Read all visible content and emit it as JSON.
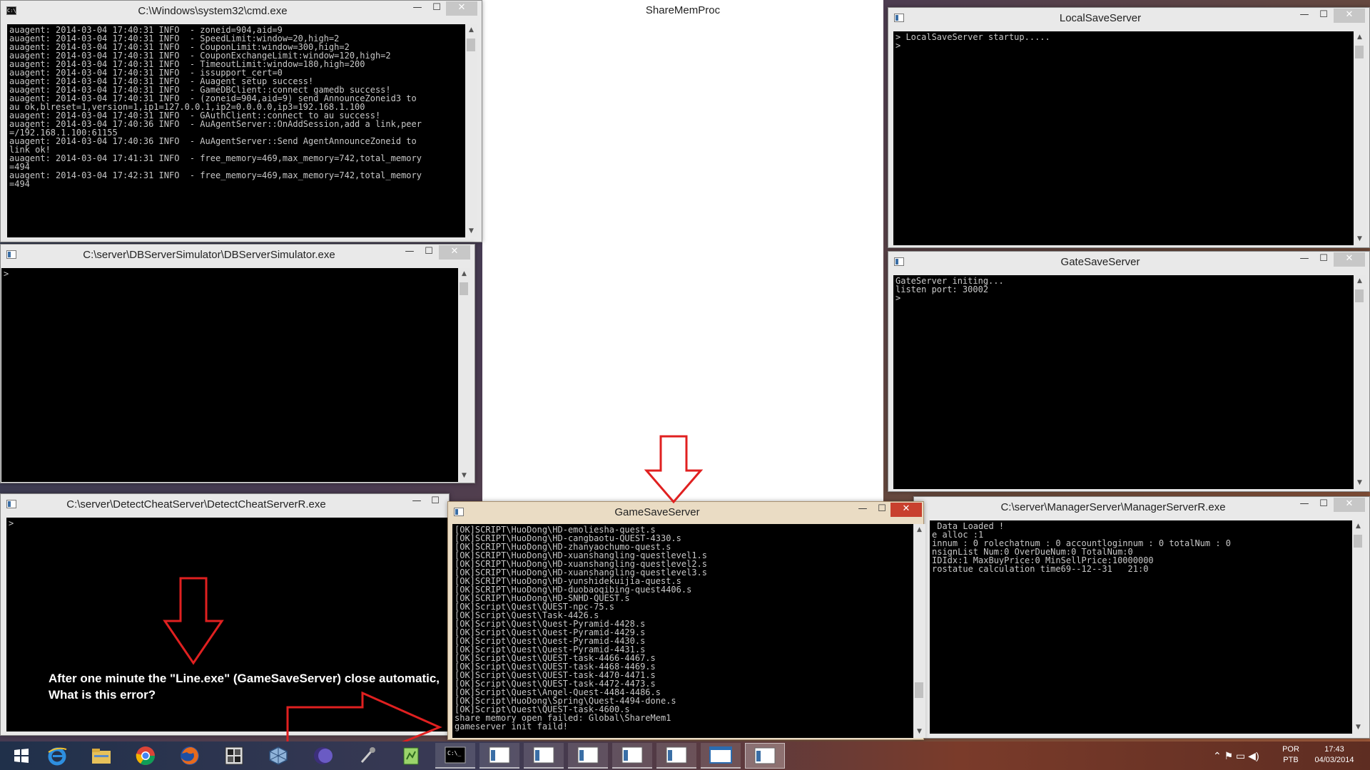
{
  "windows": {
    "cmd": {
      "title": "C:\\Windows\\system32\\cmd.exe",
      "lines": [
        "auagent: 2014-03-04 17:40:31 INFO  - zoneid=904,aid=9",
        "auagent: 2014-03-04 17:40:31 INFO  - SpeedLimit:window=20,high=2",
        "auagent: 2014-03-04 17:40:31 INFO  - CouponLimit:window=300,high=2",
        "auagent: 2014-03-04 17:40:31 INFO  - CouponExchangeLimit:window=120,high=2",
        "auagent: 2014-03-04 17:40:31 INFO  - TimeoutLimit:window=180,high=200",
        "auagent: 2014-03-04 17:40:31 INFO  - issupport_cert=0",
        "auagent: 2014-03-04 17:40:31 INFO  - Auagent setup success!",
        "auagent: 2014-03-04 17:40:31 INFO  - GameDBClient::connect gamedb success!",
        "auagent: 2014-03-04 17:40:31 INFO  - (zoneid=904,aid=9) send AnnounceZoneid3 to",
        "au ok,blreset=1,version=1,ip1=127.0.0.1,ip2=0.0.0.0,ip3=192.168.1.100",
        "auagent: 2014-03-04 17:40:31 INFO  - GAuthClient::connect to au success!",
        "auagent: 2014-03-04 17:40:36 INFO  - AuAgentServer::OnAddSession,add a link,peer",
        "=/192.168.1.100:61155",
        "auagent: 2014-03-04 17:40:36 INFO  - AuAgentServer::Send AgentAnnounceZoneid to",
        "link ok!",
        "auagent: 2014-03-04 17:41:31 INFO  - free_memory=469,max_memory=742,total_memory",
        "=494",
        "auagent: 2014-03-04 17:42:31 INFO  - free_memory=469,max_memory=742,total_memory",
        "=494"
      ]
    },
    "sharemem": {
      "title": "ShareMemProc"
    },
    "local_save": {
      "title": "LocalSaveServer",
      "lines": [
        "> LocalSaveServer startup.....",
        ">"
      ]
    },
    "db_server": {
      "title": "C:\\server\\DBServerSimulator\\DBServerSimulator.exe",
      "lines": [
        ">"
      ]
    },
    "gate_save": {
      "title": "GateSaveServer",
      "lines": [
        "GateServer initing...",
        "listen port: 30002",
        ">"
      ]
    },
    "detect_cheat": {
      "title": "C:\\server\\DetectCheatServer\\DetectCheatServerR.exe",
      "lines": [
        ">"
      ]
    },
    "game_save": {
      "title": "GameSaveServer",
      "lines": [
        "[OK]SCRIPT\\HuoDong\\HD-emoliesha-quest.s",
        "[OK]SCRIPT\\HuoDong\\HD-cangbaotu-QUEST-4330.s",
        "[OK]SCRIPT\\HuoDong\\HD-zhanyaochumo-quest.s",
        "[OK]SCRIPT\\HuoDong\\HD-xuanshangling-questlevel1.s",
        "[OK]SCRIPT\\HuoDong\\HD-xuanshangling-questlevel2.s",
        "[OK]SCRIPT\\HuoDong\\HD-xuanshangling-questlevel3.s",
        "[OK]SCRIPT\\HuoDong\\HD-yunshidekuijia-quest.s",
        "[OK]SCRIPT\\HuoDong\\HD-duobaoqibing-quest4406.s",
        "[OK]SCRIPT\\HuoDong\\HD-SNHD-QUEST.s",
        "[OK]Script\\Quest\\QUEST-npc-75.s",
        "[OK]Script\\Quest\\Task-4426.s",
        "[OK]Script\\Quest\\Quest-Pyramid-4428.s",
        "[OK]Script\\Quest\\Quest-Pyramid-4429.s",
        "[OK]Script\\Quest\\Quest-Pyramid-4430.s",
        "[OK]Script\\Quest\\Quest-Pyramid-4431.s",
        "[OK]Script\\Quest\\QUEST-task-4466-4467.s",
        "[OK]Script\\Quest\\QUEST-task-4468-4469.s",
        "[OK]Script\\Quest\\QUEST-task-4470-4471.s",
        "[OK]Script\\Quest\\QUEST-task-4472-4473.s",
        "[OK]Script\\Quest\\Angel-Quest-4484-4486.s",
        "[OK]Script\\HuoDong\\Spring\\Quest-4494-done.s",
        "[OK]Script\\Quest\\QUEST-task-4600.s",
        "share memory open failed: Global\\ShareMem1",
        "gameserver init faild!"
      ]
    },
    "manager": {
      "title": "C:\\server\\ManagerServer\\ManagerServerR.exe",
      "lines": [
        " Data Loaded !",
        "e alloc :1",
        "innum : 0 rolechatnum : 0 accountloginnum : 0 totalNum : 0",
        "nsignList Num:0 OverDueNum:0 TotalNum:0",
        "IDIdx:1 MaxBuyPrice:0 MinSellPrice:10000000",
        "rostatue calculation time69--12--31   21:0"
      ]
    }
  },
  "annotation": {
    "text": "After one minute the \"Line.exe\" (GameSaveServer) close automatic,\nWhat is this error?",
    "color": "#e02020"
  },
  "taskbar": {
    "apps": [
      "windows-logo-icon",
      "internet-explorer-icon",
      "file-explorer-icon",
      "chrome-icon",
      "firefox-icon",
      "server-app-icon",
      "virtualbox-icon",
      "eclipse-icon",
      "tool-icon",
      "notepad-plus-icon",
      "cmd-icon",
      "console-window-icon",
      "console-window-icon",
      "console-window-icon",
      "console-window-icon",
      "console-window-icon",
      "blank-window-icon",
      "console-window-icon"
    ],
    "tray": {
      "language": "POR",
      "layout": "PTB",
      "time": "17:43",
      "date": "04/03/2014"
    }
  }
}
